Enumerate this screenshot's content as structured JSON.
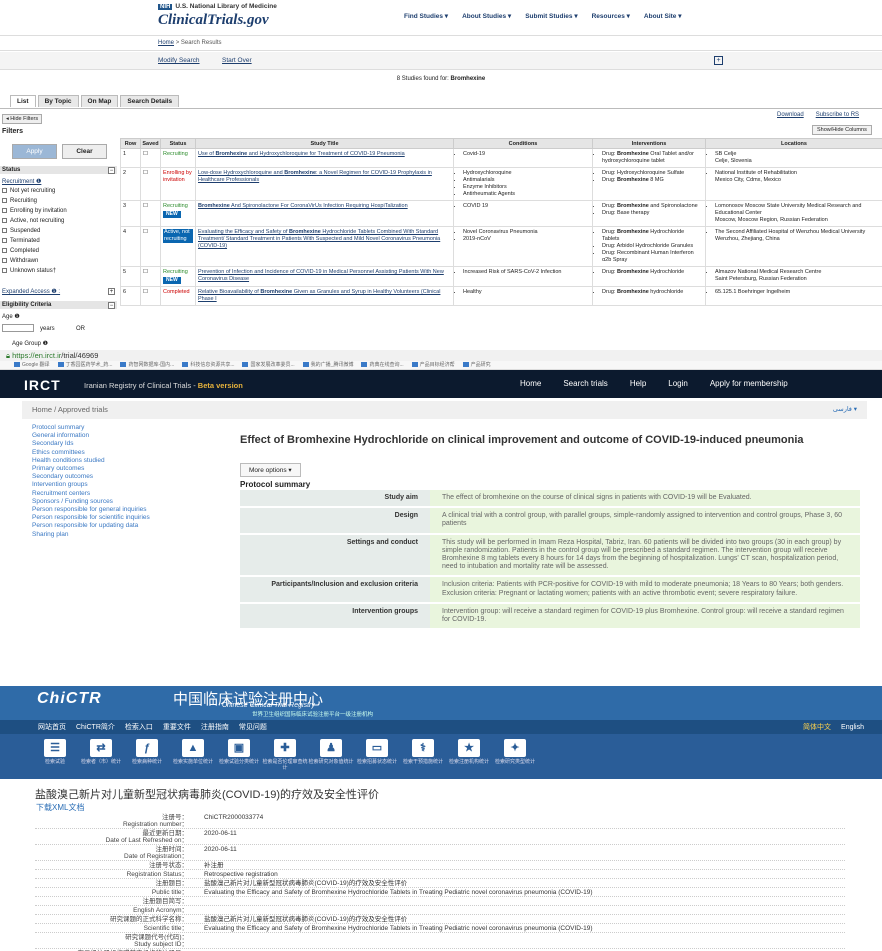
{
  "ct": {
    "nih": "NIH",
    "agency": "U.S. National Library of Medicine",
    "logo": "ClinicalTrials.gov",
    "nav": [
      "Find Studies ▾",
      "About Studies ▾",
      "Submit Studies ▾",
      "Resources ▾",
      "About Site ▾"
    ],
    "crumb_home": "Home",
    "crumb_sep": ">",
    "crumb_page": "Search Results",
    "modify": "Modify Search",
    "start_over": "Start Over",
    "found_pre": "8 Studies found for: ",
    "found_term": "Bromhexine",
    "tabs": [
      "List",
      "By Topic",
      "On Map",
      "Search Details"
    ],
    "hide_filters": "◂ Hide Filters",
    "filters": "Filters",
    "download": "Download",
    "subscribe": "Subscribe to RS",
    "show_hide": "Show/Hide Columns",
    "apply": "Apply",
    "clear": "Clear",
    "status_hdr": "Status",
    "recruitment": "Recruitment ❶",
    "status_opts": [
      "Not yet recruiting",
      "Recruiting",
      "Enrolling by invitation",
      "Active, not recruiting",
      "Suspended",
      "Terminated",
      "Completed",
      "Withdrawn",
      "Unknown status†"
    ],
    "expanded": "Expanded Access ❶ :",
    "elig_hdr": "Eligibility Criteria",
    "age": "Age ❶",
    "years": "years",
    "or": "OR",
    "age_group": "Age Group ❶",
    "cols": [
      "Row",
      "Saved",
      "Status",
      "Study Title",
      "Conditions",
      "Interventions",
      "Locations"
    ],
    "rows": [
      {
        "n": "1",
        "status": "Recruiting",
        "title": "Use of Bromhexine and Hydroxychloroquine for Treatment of COVID-19 Pneumonia",
        "cond": [
          "Covid-19"
        ],
        "int": [
          "Drug: Bromhexine Oral Tablet and/or hydroxychloroquine tablet"
        ],
        "loc": [
          "SB Celje",
          "Celje, Slovenia"
        ]
      },
      {
        "n": "2",
        "status": "Enrolling by invitation",
        "title": "Low-dose Hydroxychloroquine and Bromhexine: a Novel Regimen for COVID-19 Prophylaxis in Healthcare Professionals",
        "cond": [
          "Hydroxychloroquine",
          "Antimalarials",
          "Enzyme Inhibitors",
          "Antirheumatic Agents"
        ],
        "int": [
          "Drug: Hydroxychloroquine Sulfate",
          "Drug: Bromhexine 8 MG"
        ],
        "loc": [
          "National Institute of Rehabilitation",
          "Mexico City, Cdmx, Mexico"
        ]
      },
      {
        "n": "3",
        "status": "Recruiting",
        "badge": "NEW",
        "title": "Bromhexine And Spironolactone For CoronaVirUs Infection Requiring HospiTalization",
        "cond": [
          "COVID 19"
        ],
        "int": [
          "Drug: Bromhexine and Spironolactone",
          "Drug: Base therapy"
        ],
        "loc": [
          "Lomonosov Moscow State University Medical Research and Educational Center",
          "Moscow, Moscow Region, Russian Federation"
        ]
      },
      {
        "n": "4",
        "status": "Active, not recruiting",
        "title": "Evaluating the Efficacy and Safety of Bromhexine Hydrochloride Tablets Combined With Standard Treatment/ Standard Treatment in Patients With Suspected and Mild Novel Coronavirus Pneumonia (COVID-19)",
        "cond": [
          "Novel Coronavirus Pneumonia",
          "2019-nCoV"
        ],
        "int": [
          "Drug: Bromhexine Hydrochloride Tablets",
          "Drug: Arbidol Hydrochloride Granules",
          "Drug: Recombinant Human Interferon α2b Spray"
        ],
        "loc": [
          "The Second Affiliated Hospital of Wenzhou Medical University",
          "Wenzhou, Zhejiang, China"
        ]
      },
      {
        "n": "5",
        "status": "Recruiting",
        "badge": "NEW",
        "title": "Prevention of Infection and Incidence of COVID-19 in Medical Personnel Assisting Patients With New Coronavirus Disease",
        "cond": [
          "Increased Risk of SARS-CoV-2 Infection"
        ],
        "int": [
          "Drug: Bromhexine Hydrochloride"
        ],
        "loc": [
          "Almazov National Medical Research Centre",
          "Saint Petersburg, Russian Federation"
        ]
      },
      {
        "n": "6",
        "status": "Completed",
        "title": "Relative Bioavailability of Bromhexine Given as Granules and Syrup in Healthy Volunteers (Clinical Phase I",
        "cond": [
          "Healthy"
        ],
        "int": [
          "Drug: Bromhexine hydrochloride"
        ],
        "loc": [
          "65.125.1 Boehringer Ingelheim"
        ]
      }
    ]
  },
  "irct": {
    "url_a": "https://en.irct.ir",
    "url_b": "/trial/46969",
    "bookmarks": [
      "Google 翻译",
      "丁香园医药学术_药...",
      "药智网数据库-国内...",
      "科技信息资源共享...",
      "国家发展改革委员...",
      "我的广播_腾讯微博",
      "药典在线查询...",
      "产品目标经济帮",
      "产品研究"
    ],
    "logo": "IRCT",
    "sub": "Iranian Registry of Clinical Trials - ",
    "sub_beta": "Beta version",
    "nav": [
      "Home",
      "Search trials",
      "Help",
      "Login",
      "Apply for membership"
    ],
    "crumb": "Home  /  Approved trials",
    "lang": "فارسی ▾",
    "side": [
      "Protocol summary",
      "General information",
      "Secondary Ids",
      "Ethics committees",
      "Health conditions studied",
      "Primary outcomes",
      "Secondary outcomes",
      "Intervention groups",
      "Recruitment centers",
      "Sponsors / Funding sources",
      "Person responsible for general inquiries",
      "Person responsible for scientific inquiries",
      "Person responsible for updating data",
      "Sharing plan"
    ],
    "title": "Effect of Bromhexine Hydrochloride on clinical improvement and outcome of COVID-19-induced pneumonia",
    "more": "More options ▾",
    "ps": "Protocol summary",
    "rows": [
      {
        "k": "Study aim",
        "v": "The effect of bromhexine on the course of clinical signs in patients with COVID-19 will be Evaluated."
      },
      {
        "k": "Design",
        "v": "A clinical trial with a control group, with parallel groups, simple-randomly assigned to intervention and control groups, Phase 3, 60 patients"
      },
      {
        "k": "Settings and conduct",
        "v": "This study will be performed in Imam Reza Hospital, Tabriz, Iran. 60 patients will be divided into two groups (30 in each group) by simple randomization. Patients in the control group will be prescribed a standard regimen. The intervention group will receive Bromhexine 8 mg tablets every 8 hours for 14 days from the beginning of hospitalization. Lungs' CT scan, hospitalization period, need to intubation and mortality rate will be assessed."
      },
      {
        "k": "Participants/Inclusion and exclusion criteria",
        "v": "Inclusion criteria: Patients with PCR-positive for COVID-19 with mild to moderate pneumonia; 18 Years to 80 Years; both genders. Exclusion criteria: Pregnant or lactating women; patients with an active thrombotic event; severe respiratory failure."
      },
      {
        "k": "Intervention groups",
        "v": "Intervention group: will receive a standard regimen for COVID-19 plus Bromhexine. Control group: will receive a standard regimen for COVID-19."
      }
    ]
  },
  "chictr": {
    "logo": "ChiCTR",
    "cn": "中国临床试验注册中心",
    "en": "Chinese Clinical Trial Registry",
    "who": "世界卫生组织国际临床试验注册平台一级注册机构",
    "nav": [
      "网站首页",
      "ChiCTR简介",
      "检索入口",
      "重要文件",
      "注册指南",
      "常见问题"
    ],
    "lang_cn": "简体中文",
    "lang_en": "English",
    "icons": [
      {
        "g": "☰",
        "t": "检索试验"
      },
      {
        "g": "⇄",
        "t": "检索者（市）统计"
      },
      {
        "g": "ƒ",
        "t": "检索病种统计"
      },
      {
        "g": "▲",
        "t": "检索实施单位统计"
      },
      {
        "g": "▣",
        "t": "检索试验分类统计"
      },
      {
        "g": "✚",
        "t": "检索是否伦理审查统计"
      },
      {
        "g": "♟",
        "t": "检索研究对象值统计"
      },
      {
        "g": "▭",
        "t": "检索招募状态统计"
      },
      {
        "g": "⚕",
        "t": "检索干预措施统计"
      },
      {
        "g": "★",
        "t": "检索注册机构统计"
      },
      {
        "g": "✦",
        "t": "检索研究类型统计"
      }
    ],
    "title": "盐酸溴己新片对儿童新型冠状病毒肺炎(COVID-19)的疗效及安全性评价",
    "xml": "下载XML文档",
    "rows": [
      {
        "k": "注册号：\nRegistration number：",
        "v": "ChiCTR2000033774"
      },
      {
        "k": "最近更新日期：\nDate of Last Refreshed on：",
        "v": "2020-06-11"
      },
      {
        "k": "注册时间：\nDate of Registration：",
        "v": "2020-06-11"
      },
      {
        "k": "注册号状态：",
        "v": "补注册"
      },
      {
        "k": "Registration Status：",
        "v": "Retrospective registration"
      },
      {
        "k": "注册题目：",
        "v": "盐酸溴己新片对儿童新型冠状病毒肺炎(COVID-19)的疗效及安全性评价"
      },
      {
        "k": "Public title：",
        "v": "Evaluating the Efficacy and Safety of Bromhexine Hydrochloride Tablets in Treating Pediatric novel coronavirus pneumonia (COVID-19)"
      },
      {
        "k": "注册题目简写：",
        "v": ""
      },
      {
        "k": "English Acronym：",
        "v": ""
      },
      {
        "k": "研究课题的正式科学名称：",
        "v": "盐酸溴己新片对儿童新型冠状病毒肺炎(COVID-19)的疗效及安全性评价"
      },
      {
        "k": "Scientific title：",
        "v": "Evaluating the Efficacy and Safety of Bromhexine Hydrochloride Tablets in Treating Pediatric novel coronavirus pneumonia (COVID-19)"
      },
      {
        "k": "研究课题代号(代码)：\nStudy subject ID：",
        "v": ""
      },
      {
        "k": "在二级注册机构或其它机构的注册号：\nThe registration number of the Partner Registry or other register：",
        "v": ""
      }
    ]
  }
}
